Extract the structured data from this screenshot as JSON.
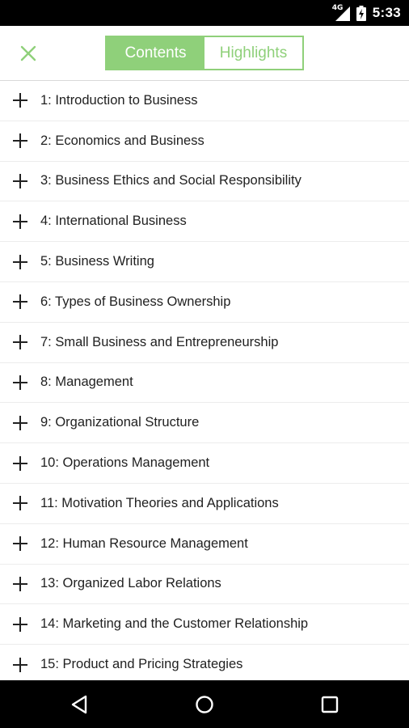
{
  "status_bar": {
    "network": "4G",
    "time": "5:33",
    "icons": [
      "signal-icon",
      "battery-charging-icon"
    ]
  },
  "toolbar": {
    "close_icon": "close-icon",
    "tabs": [
      {
        "label": "Contents",
        "active": true
      },
      {
        "label": "Highlights",
        "active": false
      }
    ]
  },
  "chapters": [
    {
      "label": "1: Introduction to Business"
    },
    {
      "label": "2: Economics and Business"
    },
    {
      "label": "3: Business Ethics and Social Responsibility"
    },
    {
      "label": "4: International Business"
    },
    {
      "label": "5: Business Writing"
    },
    {
      "label": "6: Types of Business Ownership"
    },
    {
      "label": "7: Small Business and Entrepreneurship"
    },
    {
      "label": "8: Management"
    },
    {
      "label": "9: Organizational Structure"
    },
    {
      "label": "10: Operations Management"
    },
    {
      "label": "11: Motivation Theories and Applications"
    },
    {
      "label": "12: Human Resource Management"
    },
    {
      "label": "13: Organized Labor Relations"
    },
    {
      "label": "14: Marketing and the Customer Relationship"
    },
    {
      "label": "15: Product and Pricing Strategies"
    }
  ],
  "nav_bar": {
    "icons": [
      "back-icon",
      "home-icon",
      "recents-icon"
    ]
  },
  "colors": {
    "accent": "#8fd07a",
    "text": "#212121",
    "divider": "#ececec"
  }
}
